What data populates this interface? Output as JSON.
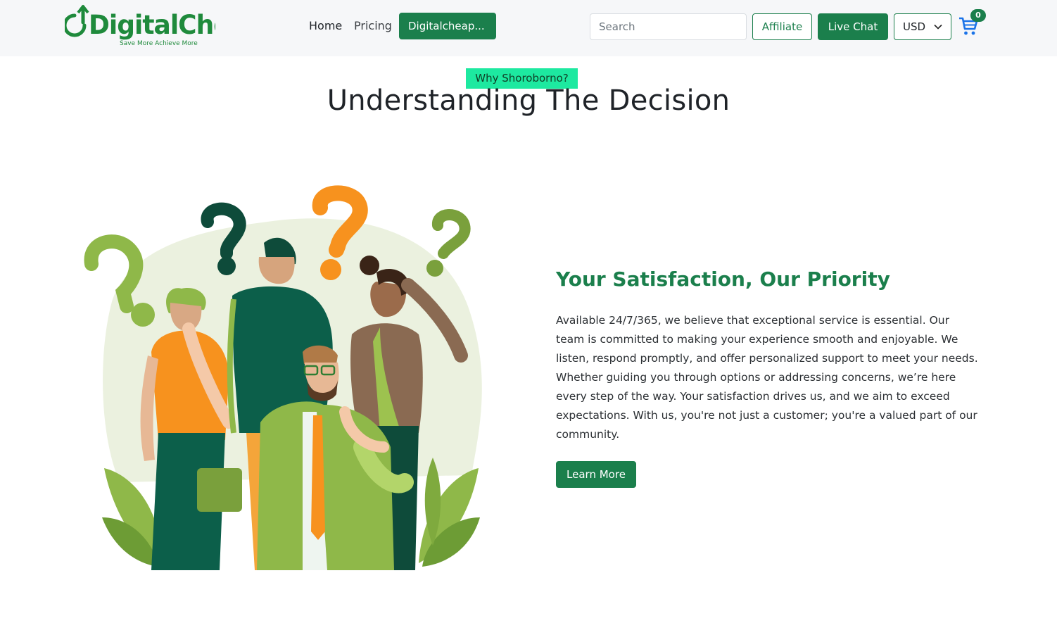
{
  "header": {
    "logo_text": "DigitalCheap",
    "logo_tagline": "Save More Achieve More",
    "nav": {
      "home": "Home",
      "pricing": "Pricing",
      "digitalcheap": "Digitalcheap..."
    },
    "search_placeholder": "Search",
    "affiliate_label": "Affiliate",
    "live_chat_label": "Live Chat",
    "currency": "USD",
    "cart_count": "0"
  },
  "hero": {
    "eyebrow": "Why Shoroborno?",
    "headline": "Understanding The Decision"
  },
  "feature": {
    "title": "Your Satisfaction, Our Priority",
    "body": "Available 24/7/365, we believe that exceptional service is essential. Our team is committed to making your experience smooth and enjoyable. We listen, respond promptly, and offer personalized support to meet your needs. Whether guiding you through options or addressing concerns, we’re here every step of the way. Your satisfaction drives us, and we aim to exceed expectations. With us, you're not just a customer; you're a valued part of our community.",
    "cta_label": "Learn More"
  },
  "colors": {
    "brand_green": "#1b7f4c",
    "eyebrow_bg": "#1de9a0",
    "header_bg": "#f6f7f9",
    "cart_icon": "#1a73e8"
  },
  "icons": {
    "cart": "shopping-cart-icon",
    "chevron": "chevron-down-icon",
    "logo_mark": "download-arrow-icon"
  }
}
